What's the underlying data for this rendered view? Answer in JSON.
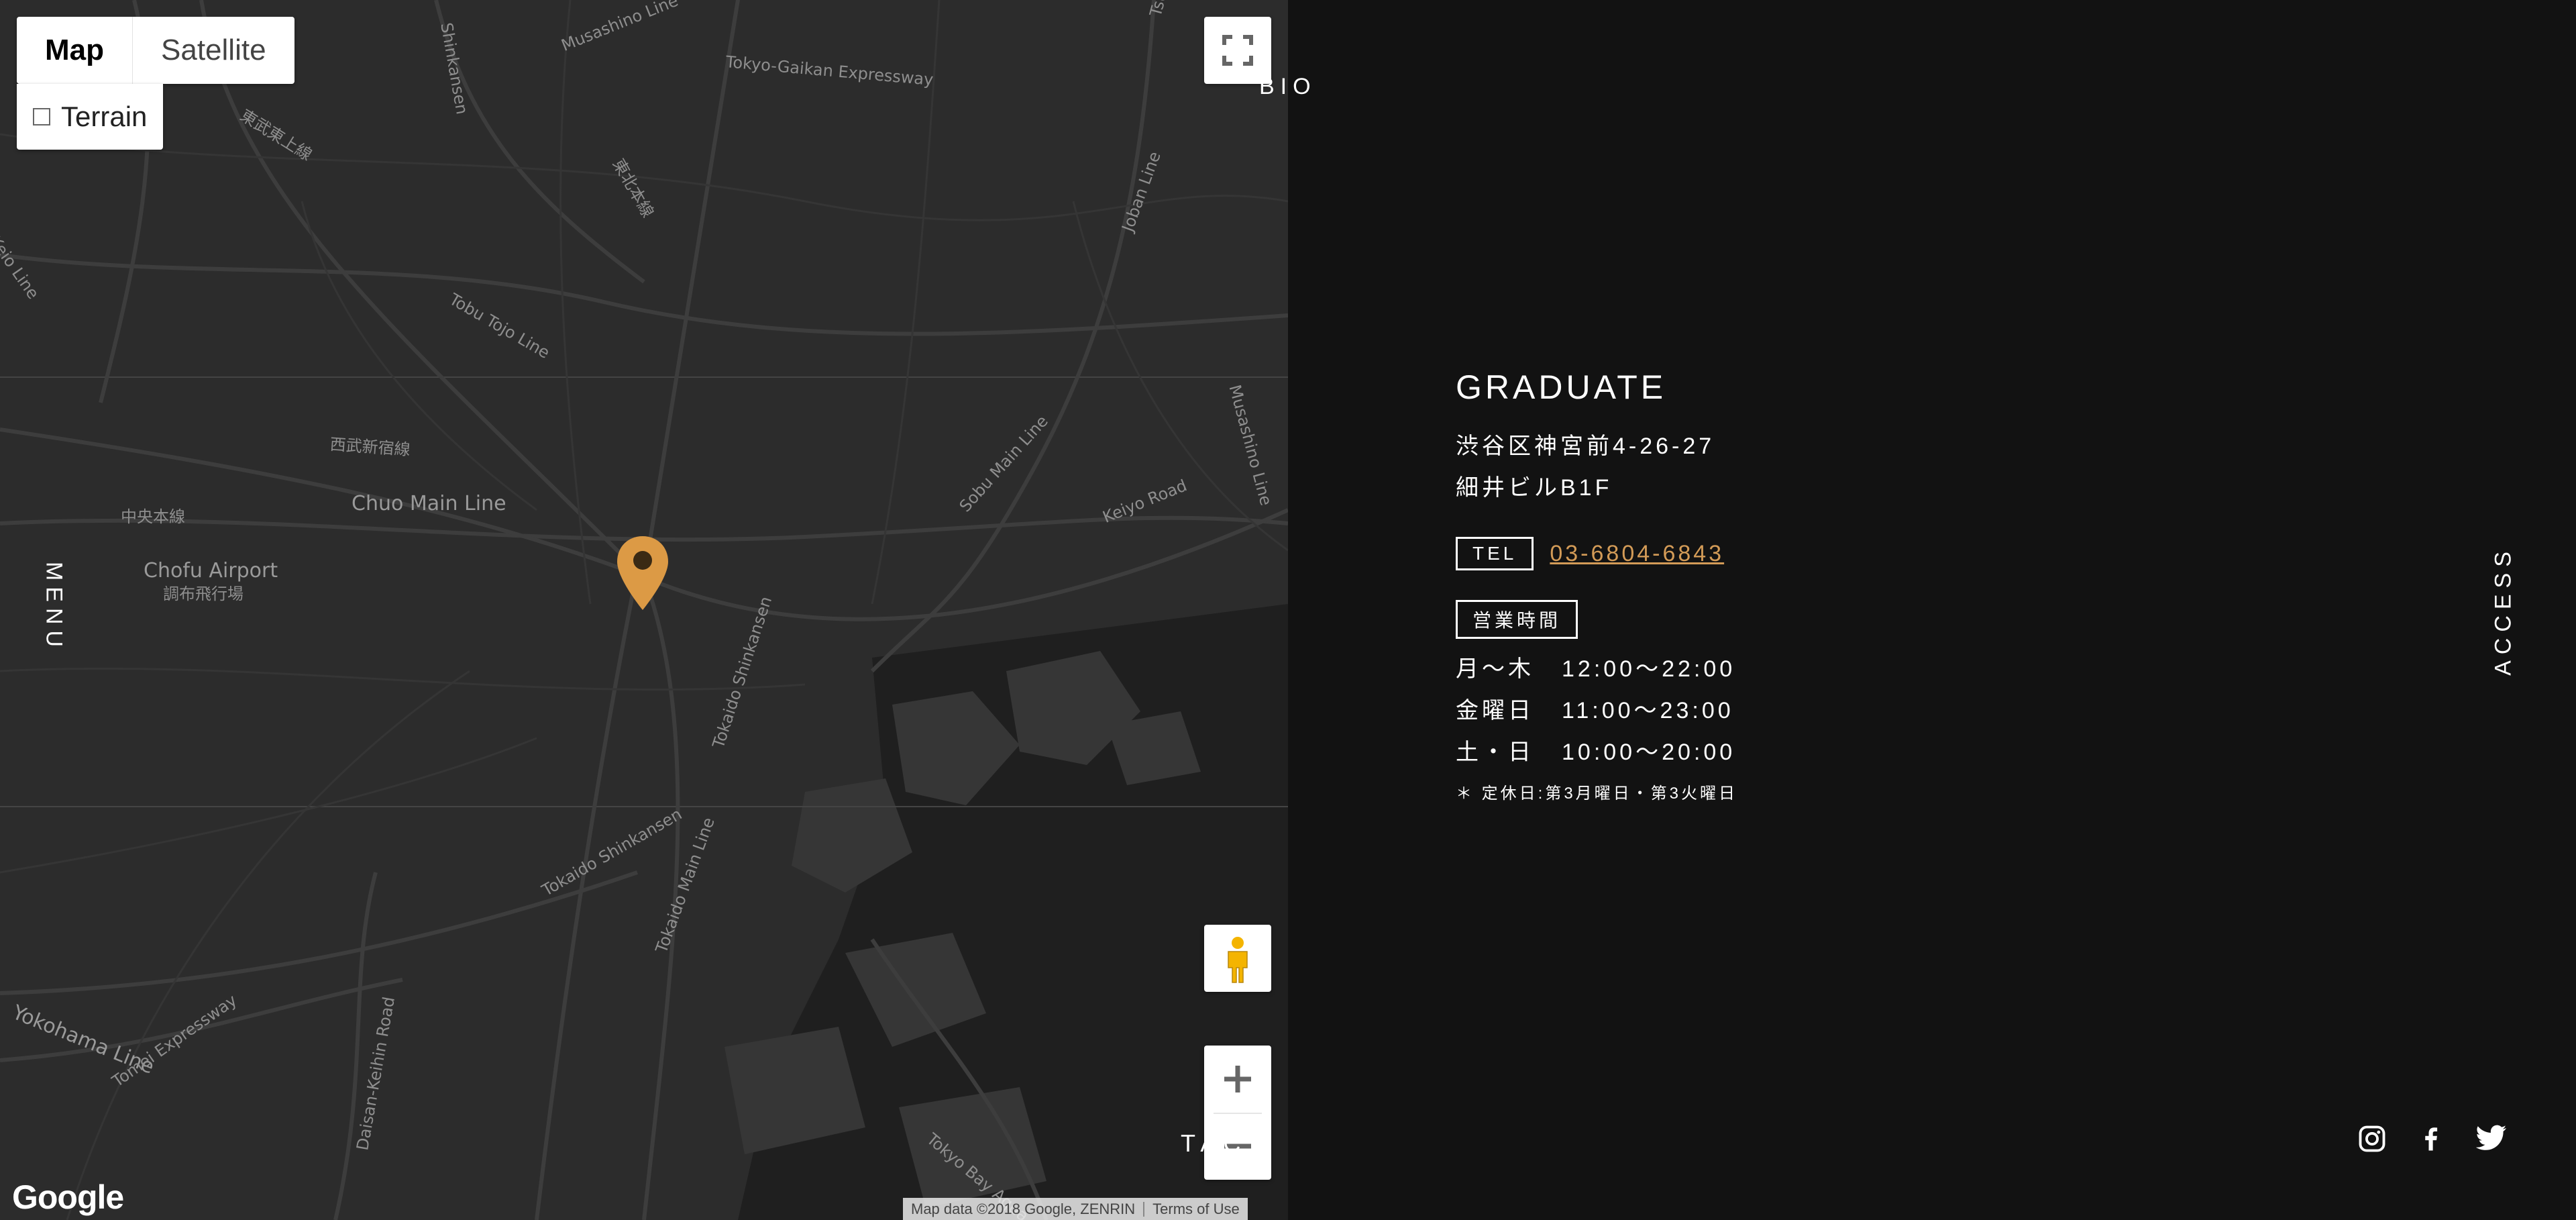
{
  "map": {
    "map_type": {
      "map_label": "Map",
      "satellite_label": "Satellite",
      "selected": "Map"
    },
    "terrain_label": "Terrain",
    "terrain_checked": false,
    "google_logo": "Google",
    "attribution": {
      "data": "Map data ©2018 Google, ZENRIN",
      "terms": "Terms of Use"
    },
    "pin_color": "#dc9a45",
    "labels": [
      "Shinkansen",
      "Musashino Line",
      "Tokyo-Gaikan Expressway",
      "Tsukuba",
      "東武東上線",
      "東北本線",
      "Joban Line",
      "Keio Line",
      "Tobu Tojo Line",
      "西武新宿線",
      "Chuo Main Line",
      "中央本線",
      "Chofu Airport",
      "調布飛行場",
      "Sobu Main Line",
      "Keiyo Road",
      "Musashino Line",
      "Tokaido Shinkansen",
      "Tokaido Main Line",
      "Tokaido Shinkansen",
      "Yokohama Line",
      "Tomei Expressway",
      "Daisan-Keihin Road",
      "Tokyo Bay Aqua"
    ]
  },
  "nav": {
    "menu": "MENU",
    "bio": "BIO",
    "access": "ACCESS",
    "contact": "TACT"
  },
  "info": {
    "name": "GRADUATE",
    "address_line1": "渋谷区神宮前4-26-27",
    "address_line2": "細井ビルB1F",
    "tel_label": "TEL",
    "tel_number": "03-6804-6843",
    "hours_label": "営業時間",
    "hours": [
      {
        "day": "月～木",
        "time": "12:00～22:00"
      },
      {
        "day": "金曜日",
        "time": "11:00～23:00"
      },
      {
        "day": "土・日",
        "time": "10:00～20:00"
      }
    ],
    "holiday": "＊ 定休日:第3月曜日・第3火曜日",
    "accent_color": "#d39b57"
  },
  "social": [
    "instagram-icon",
    "facebook-icon",
    "twitter-icon"
  ]
}
